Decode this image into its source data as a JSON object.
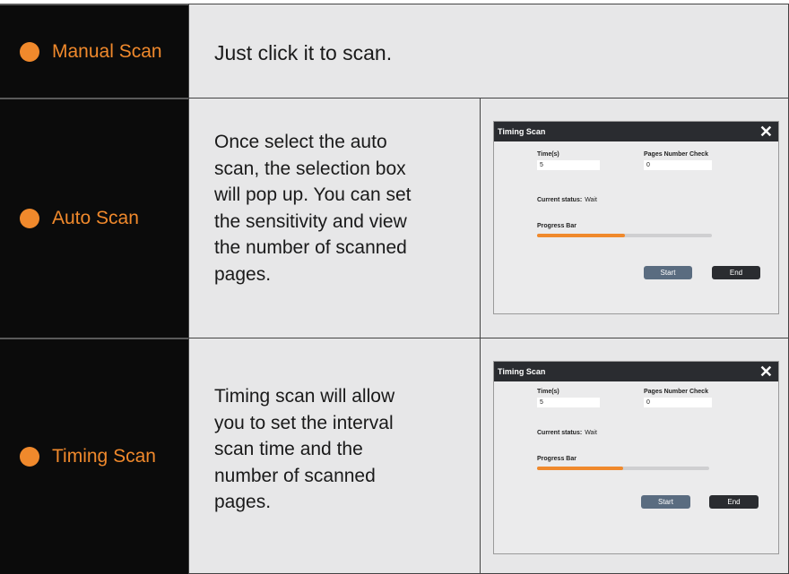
{
  "rows": [
    {
      "label": "Manual Scan",
      "description": "Just click it to scan."
    },
    {
      "label": "Auto Scan",
      "description": "Once select the auto\nscan, the selection box\nwill pop up. You can set\n the sensitivity and view\nthe number of scanned\npages."
    },
    {
      "label": "Timing Scan",
      "description": "Timing scan will allow\nyou to set the interval\nscan time and the\nnumber of scanned\npages."
    }
  ],
  "dialog": {
    "title": "Timing Scan",
    "close_icon": "✕",
    "time_label": "Time(s)",
    "time_value": "5",
    "pages_label": "Pages Number Check",
    "pages_value": "0",
    "status_label": "Current status:",
    "status_value": "Wait",
    "progress_label": "Progress Bar",
    "progress_fraction": 0.5,
    "start_label": "Start",
    "end_label": "End"
  },
  "colors": {
    "accent": "#f0892c",
    "label_bg": "#0b0b0b",
    "cell_bg": "#e7e7e8",
    "titlebar": "#2a2c30",
    "start_button": "#5a6c80"
  }
}
